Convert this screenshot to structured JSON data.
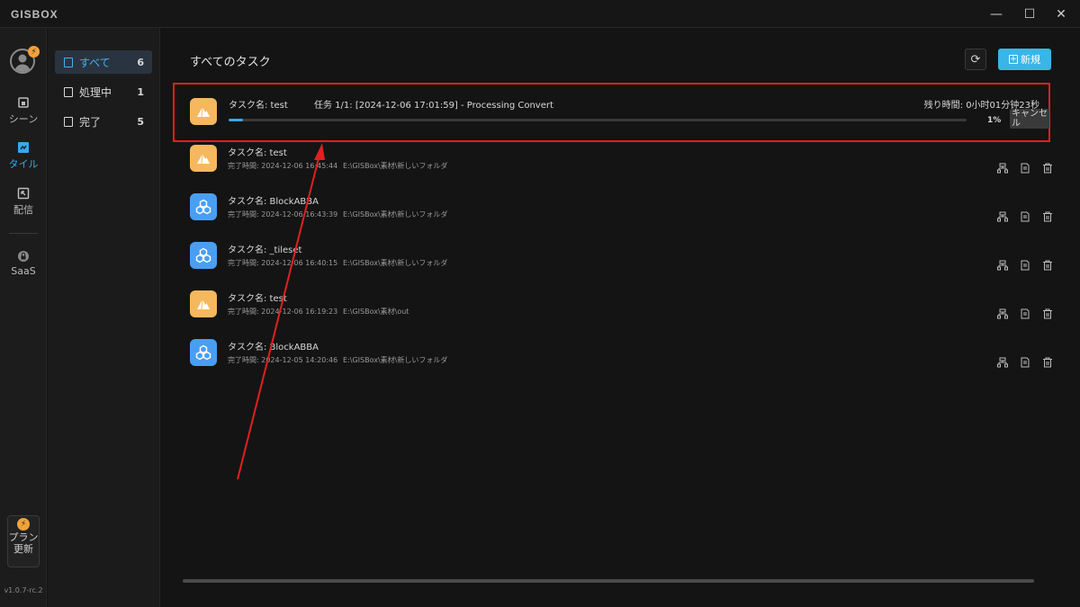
{
  "app": {
    "logo": "GISBOX",
    "version": "v1.0.7-rc.2"
  },
  "window_controls": {
    "minimize": "—",
    "maximize": "☐",
    "close": "✕"
  },
  "sidebar": {
    "items": [
      {
        "label": "シーン",
        "icon": "home-icon"
      },
      {
        "label": "タイル",
        "icon": "tile-icon",
        "active": true
      },
      {
        "label": "配信",
        "icon": "publish-icon"
      },
      {
        "label": "SaaS",
        "icon": "lock-icon"
      }
    ],
    "upgrade_label": "プラン更新"
  },
  "filters": [
    {
      "label": "すべて",
      "count": "6",
      "active": true
    },
    {
      "label": "処理中",
      "count": "1"
    },
    {
      "label": "完了",
      "count": "5"
    }
  ],
  "header": {
    "title": "すべてのタスク",
    "new_label": "新規"
  },
  "active_task": {
    "name": "タスク名:  test",
    "detail": "任务 1/1:  [2024-12-06 17:01:59]  -  Processing Convert",
    "remaining": "残り時間:  0小时01分钟23秒",
    "progress": 0.01,
    "percent": "1%",
    "cancel": "キャンセル",
    "icon": "orange"
  },
  "tasks": [
    {
      "name": "タスク名:  test",
      "time": "完了時間:  2024-12-06 16:45:44",
      "path": "E:\\GISBox\\素材\\新しいフォルダ",
      "icon": "orange"
    },
    {
      "name": "タスク名:  BlockABBA",
      "time": "完了時間:  2024-12-06 16:43:39",
      "path": "E:\\GISBox\\素材\\新しいフォルダ",
      "icon": "blue"
    },
    {
      "name": "タスク名:  _tileset",
      "time": "完了時間:  2024-12-06 16:40:15",
      "path": "E:\\GISBox\\素材\\新しいフォルダ",
      "icon": "blue"
    },
    {
      "name": "タスク名:  test",
      "time": "完了時間:  2024-12-06 16:19:23",
      "path": "E:\\GISBox\\素材\\out",
      "icon": "orange"
    },
    {
      "name": "タスク名:  BlockABBA",
      "time": "完了時間:  2024-12-05 14:20:46",
      "path": "E:\\GISBox\\素材\\新しいフォルダ",
      "icon": "blue"
    }
  ],
  "colors": {
    "accent": "#3ab6e6",
    "highlight": "#e02020",
    "orange_icon": "#f5b85e",
    "blue_icon": "#4a9ef2"
  }
}
